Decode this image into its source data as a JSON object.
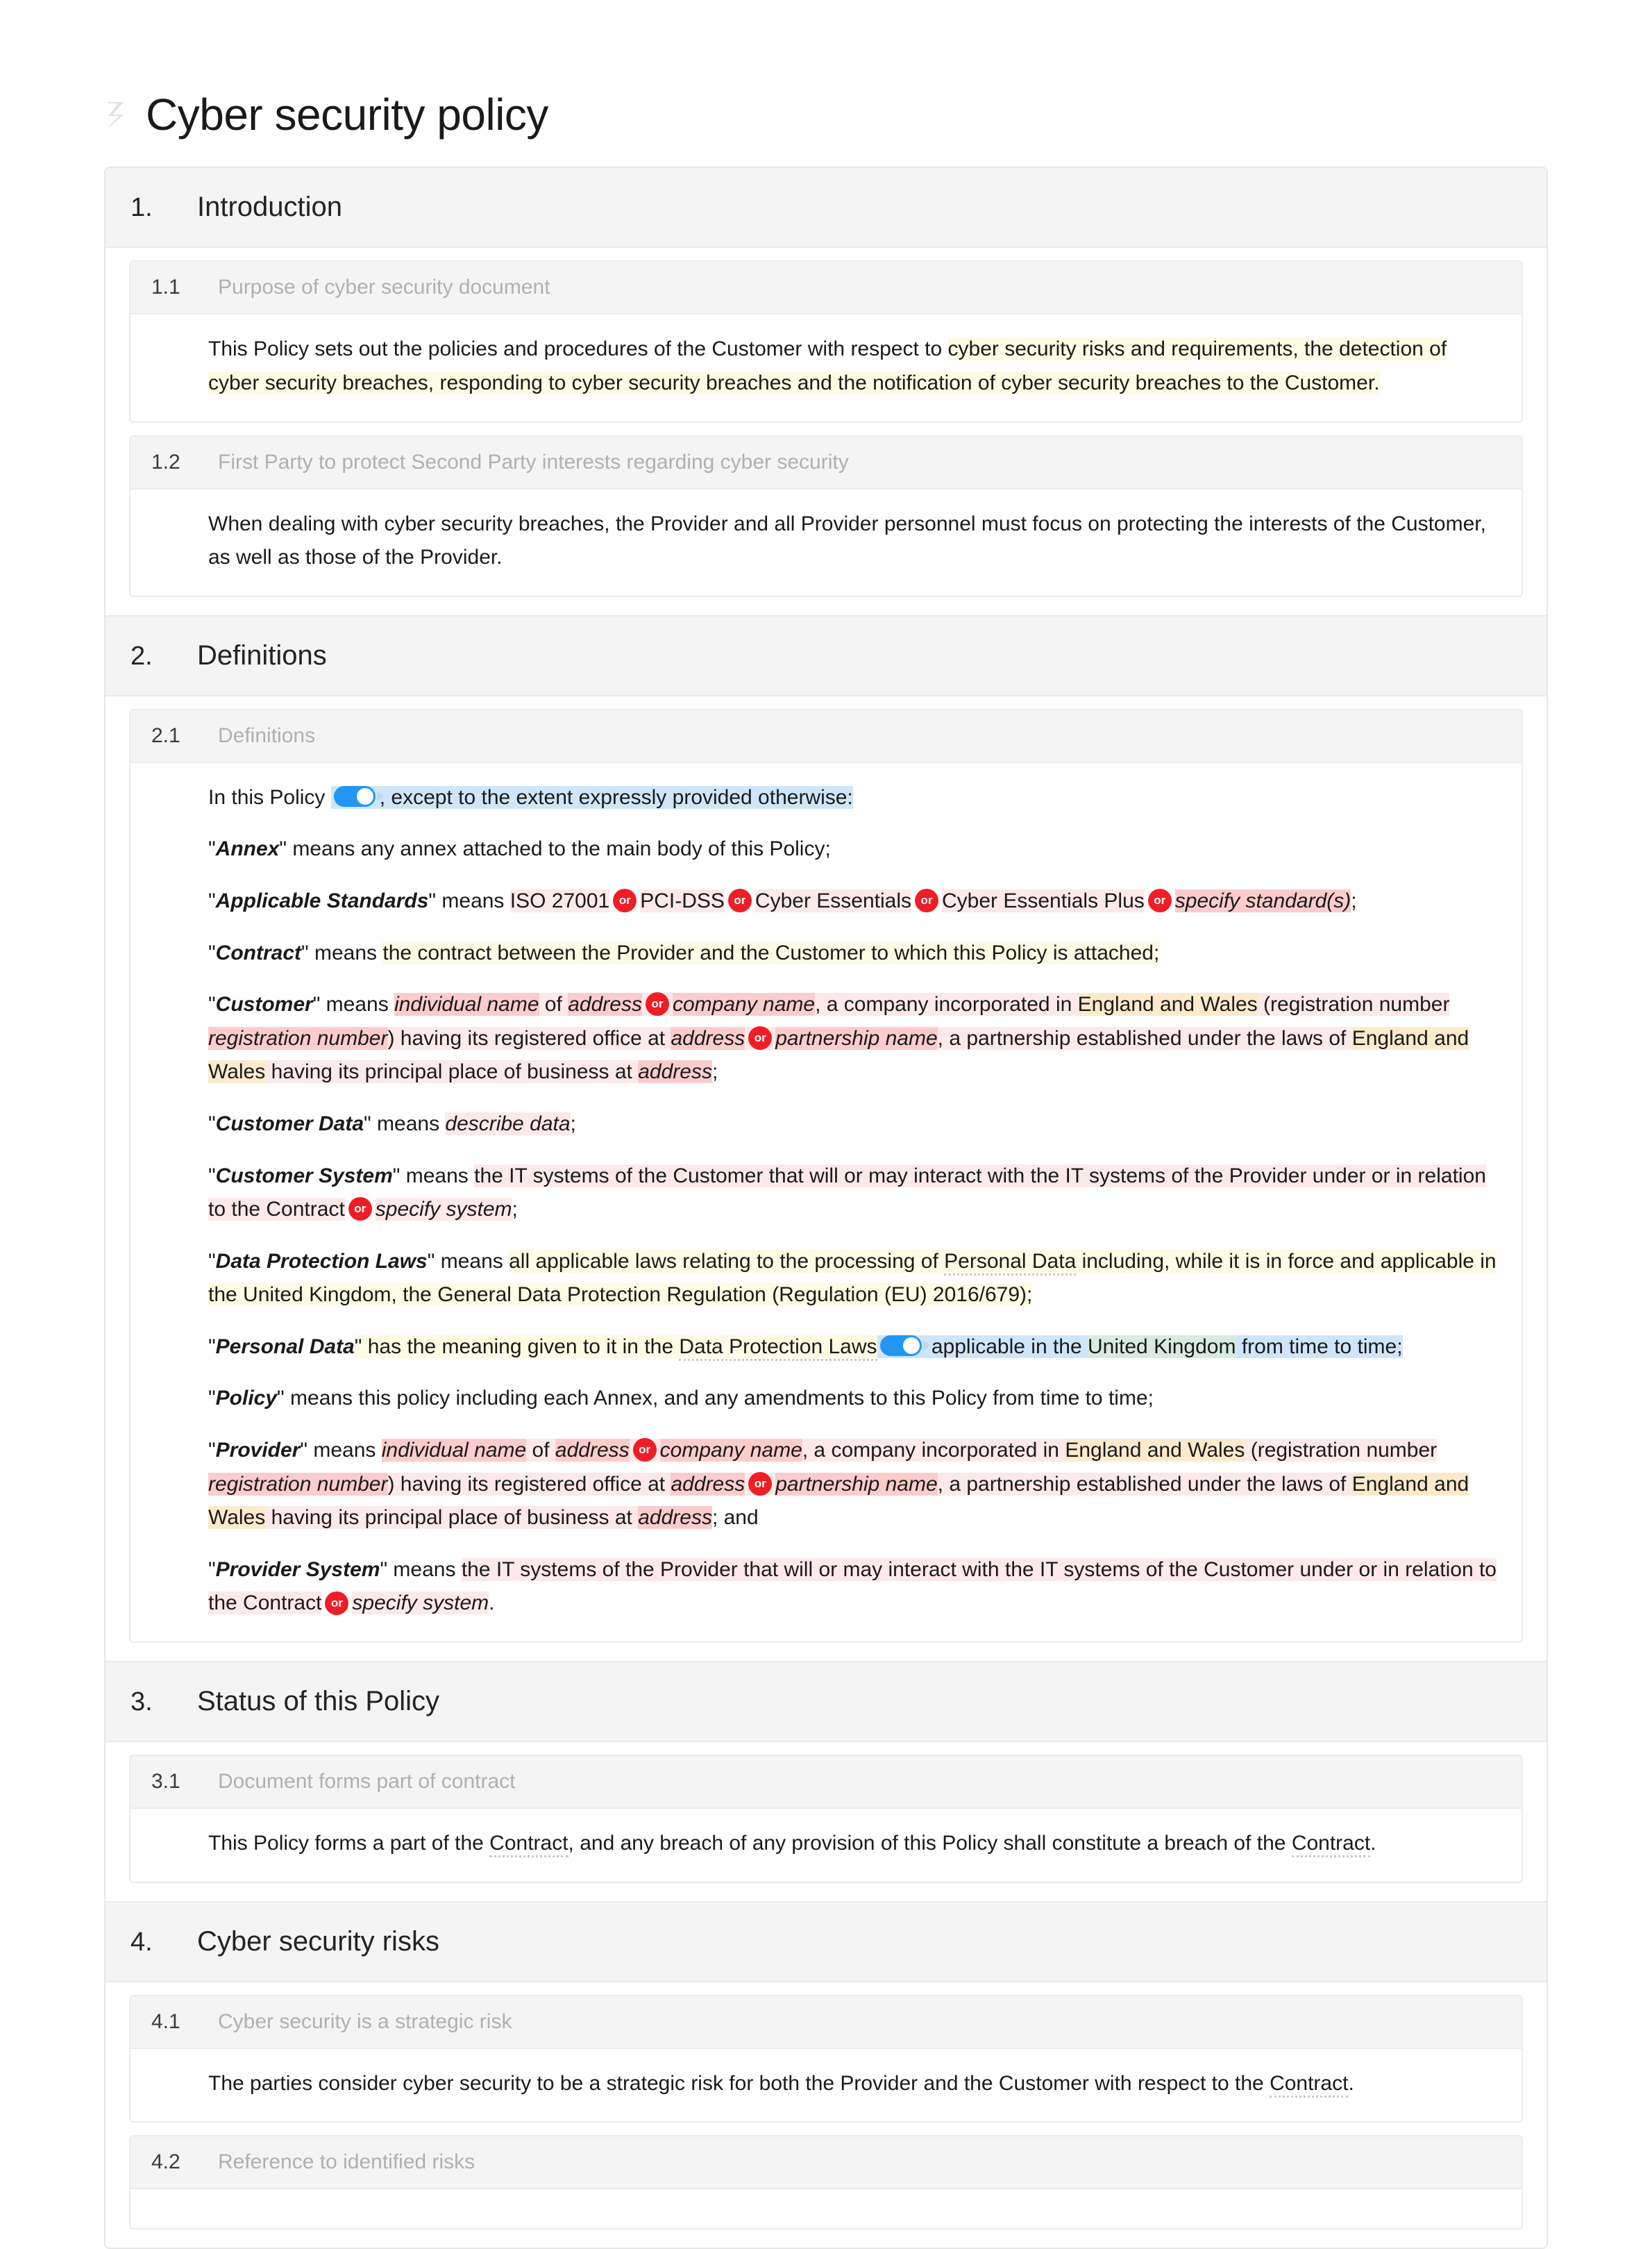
{
  "header": {
    "title": "Cyber security policy",
    "icon": "document-z-icon"
  },
  "colors": {
    "or_badge": "#ef1d26",
    "toggle_on": "#2196f3",
    "highlight_yellow": "#fcfbe3",
    "highlight_pink": "#fbdcdc",
    "highlight_blue": "#cfe6fa",
    "highlight_orange": "#fdeacd",
    "highlight_green": "#d7ece0",
    "section_header_bg": "#f4f4f4",
    "clause_title_gray": "#b0b0b0"
  },
  "badges": {
    "or": "or"
  },
  "sections": [
    {
      "number": "1.",
      "title": "Introduction",
      "clauses": [
        {
          "number": "1.1",
          "title": "Purpose of cyber security document",
          "text_plain": "This Policy sets out the policies and procedures of the Customer with respect to cyber security risks and requirements, the detection of cyber security breaches, responding to cyber security breaches and the notification of cyber security breaches to the Customer.",
          "lead": "This Policy sets out the policies and procedures of the Customer with respect to ",
          "highlight": "cyber security risks and requirements, the detection of cyber security breaches, responding to cyber security breaches and the notification of cyber security breaches to the Customer."
        },
        {
          "number": "1.2",
          "title": "First Party to protect Second Party interests regarding cyber security",
          "text_plain": "When dealing with cyber security breaches, the Provider and all Provider personnel must focus on protecting the interests of the Customer, as well as those of the Provider."
        }
      ]
    },
    {
      "number": "2.",
      "title": "Definitions",
      "clauses": [
        {
          "number": "2.1",
          "title": "Definitions"
        }
      ]
    },
    {
      "number": "3.",
      "title": "Status of this Policy",
      "clauses": [
        {
          "number": "3.1",
          "title": "Document forms part of contract",
          "text_plain": "This Policy forms a part of the Contract, and any breach of any provision of this Policy shall constitute a breach of the Contract."
        }
      ]
    },
    {
      "number": "4.",
      "title": "Cyber security risks",
      "clauses": [
        {
          "number": "4.1",
          "title": "Cyber security is a strategic risk",
          "text_plain": "The parties consider cyber security to be a strategic risk for both the Provider and the Customer with respect to the Contract."
        },
        {
          "number": "4.2",
          "title": "Reference to identified risks"
        }
      ]
    }
  ],
  "definitions_intro": {
    "lead": "In this Policy",
    "rest": ", except to the extent expressly provided otherwise:"
  },
  "definitions": {
    "annex": {
      "term": "Annex",
      "body": "\" means any annex attached to the main body of this Policy;"
    },
    "applicable_standards": {
      "term": "Applicable Standards",
      "means": "\" means ",
      "options": [
        "ISO 27001",
        "PCI-DSS",
        "Cyber Essentials",
        "Cyber Essentials Plus"
      ],
      "placeholder": "specify standard(s)",
      "tail": ";"
    },
    "contract": {
      "term": "Contract",
      "means": "\" means ",
      "body": "the contract between the Provider and the Customer to which this Policy is attached;"
    },
    "customer": {
      "term": "Customer",
      "means": "\" means ",
      "individual_name": "individual name",
      "of": " of ",
      "address1": "address",
      "company_name": "company name",
      "seg1": ", a company incorporated in ",
      "jurisdiction1": "England and Wales",
      "seg2": " (registration number ",
      "registration_number": "registration number",
      "seg3": ") having its registered office at ",
      "address2": "address",
      "partnership_name": "partnership name",
      "seg4": ", a partnership established under the laws of ",
      "jurisdiction2": "England and Wales",
      "seg5": " having its principal place of business at ",
      "address3": "address",
      "tail": ";"
    },
    "customer_data": {
      "term": "Customer Data",
      "means": "\" means ",
      "placeholder": "describe data",
      "tail": ";"
    },
    "customer_system": {
      "term": "Customer System",
      "means": "\" means ",
      "body": "the IT systems of the Customer that will or may interact with the IT systems of the Provider under or in relation to the Contract",
      "placeholder": "specify system",
      "tail": ";"
    },
    "data_protection_laws": {
      "term": "Data Protection Laws",
      "means": "\" means ",
      "body_a": "all applicable laws relating to the processing of ",
      "personal_data_ref": "Personal Data",
      "body_b": " including, while it is in force and applicable in the United Kingdom, the General Data Protection Regulation (Regulation (EU) 2016/679);"
    },
    "personal_data": {
      "term": "Personal Data",
      "body_a": "\" has the meaning given to it in the ",
      "dpl_ref": "Data Protection Laws",
      "body_b": " applicable in the ",
      "territory": "United Kingdom",
      "body_c": " from time to time;"
    },
    "policy": {
      "term": "Policy",
      "body": "\" means this policy including each Annex, and any amendments to this Policy from time to time;"
    },
    "provider": {
      "term": "Provider",
      "means": "\" means ",
      "individual_name": "individual name",
      "of": " of ",
      "address1": "address",
      "company_name": "company name",
      "seg1": ", a company incorporated in ",
      "jurisdiction1": "England and Wales",
      "seg2": " (registration number ",
      "registration_number": "registration number",
      "seg3": ") having its registered office at ",
      "address2": "address",
      "partnership_name": "partnership name",
      "seg4": ", a partnership established under the laws of ",
      "jurisdiction2": "England and Wales",
      "seg5": " having its principal place of business at ",
      "address3": "address",
      "tail": "; and"
    },
    "provider_system": {
      "term": "Provider System",
      "means": "\" means ",
      "body": "the IT systems of the Provider that will or may interact with the IT systems of the Customer under or in relation to the Contract",
      "placeholder": "specify system",
      "tail": "."
    }
  }
}
